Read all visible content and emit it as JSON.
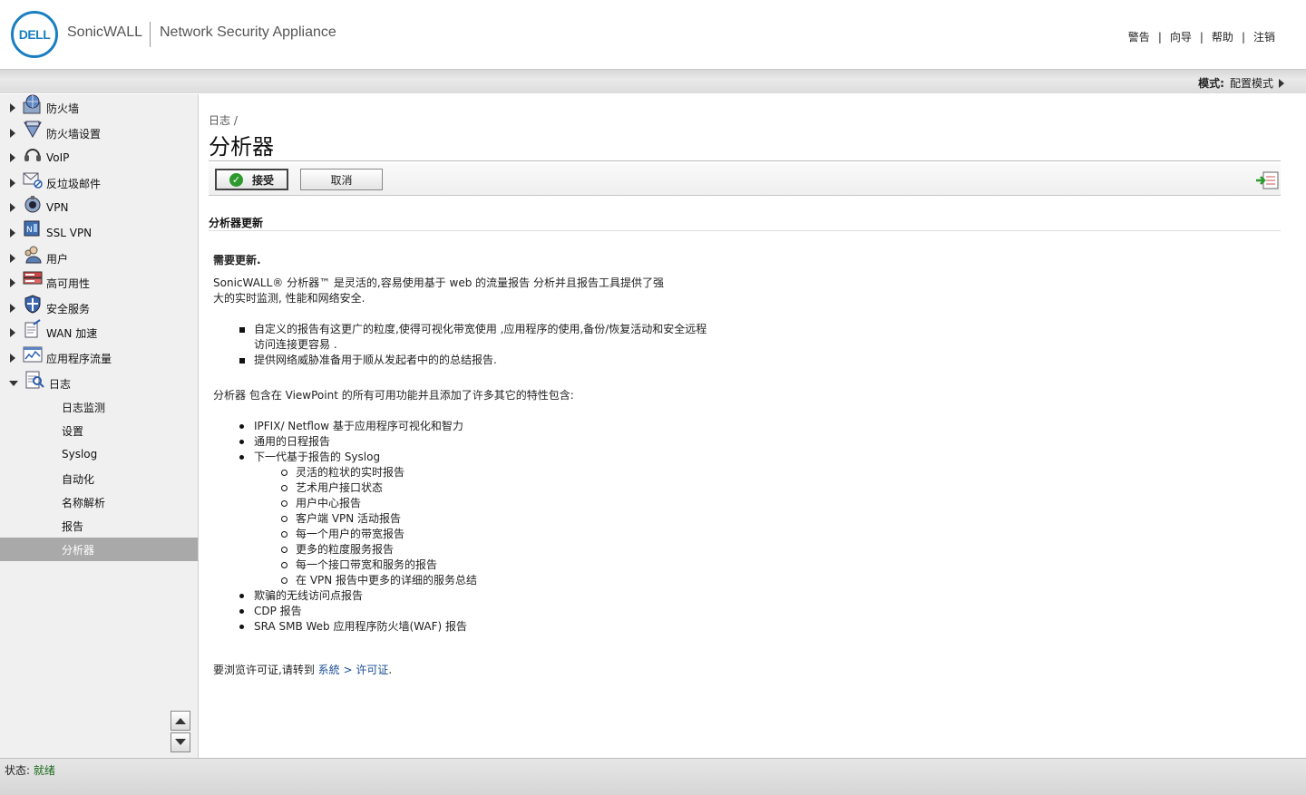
{
  "header": {
    "logo_text": "DELL",
    "brand": "SonicWALL",
    "product": "Network Security Appliance",
    "links": [
      "警告",
      "向导",
      "帮助",
      "注销"
    ]
  },
  "modebar": {
    "mode_label": "模式:",
    "mode_value": "配置模式"
  },
  "sidebar": {
    "items": [
      {
        "label": "防火墙",
        "icon": "firewall-icon"
      },
      {
        "label": "防火墙设置",
        "icon": "firewall-settings-icon"
      },
      {
        "label": "VoIP",
        "icon": "headset-icon"
      },
      {
        "label": "反垃圾邮件",
        "icon": "mail-icon"
      },
      {
        "label": "VPN",
        "icon": "lock-icon"
      },
      {
        "label": "SSL VPN",
        "icon": "ssl-vpn-icon"
      },
      {
        "label": "用户",
        "icon": "users-icon"
      },
      {
        "label": "高可用性",
        "icon": "server-icon"
      },
      {
        "label": "安全服务",
        "icon": "shield-icon"
      },
      {
        "label": "WAN 加速",
        "icon": "document-arrow-icon"
      },
      {
        "label": "应用程序流量",
        "icon": "chart-icon"
      },
      {
        "label": "日志",
        "icon": "log-search-icon"
      }
    ],
    "subitems": [
      "日志监测",
      "设置",
      "Syslog",
      "自动化",
      "名称解析",
      "报告",
      "分析器"
    ]
  },
  "main": {
    "breadcrumb": "日志 /",
    "title": "分析器",
    "accept_label": "接受",
    "cancel_label": "取消",
    "section_title": "分析器更新",
    "need_update": "需要更新.",
    "intro": "SonicWALL® 分析器™ 是灵活的,容易使用基于  web 的流量报告  分析并且报告工具提供了强大的实时监测, 性能和网络安全.",
    "features": [
      "自定义的报告有这更广的粒度,使得可视化带宽使用  ,应用程序的使用,备份/恢复活动和安全远程访问连接更容易  .",
      "提供网络威胁准备用于顺从发起者中的的总结报告."
    ],
    "viewpoint_intro": "分析器  包含在  ViewPoint 的所有可用功能并且添加了许多其它的特性包含:",
    "bullets": [
      "IPFIX/ Netflow 基于应用程序可视化和智力",
      "通用的日程报告",
      "下一代基于报告的  Syslog"
    ],
    "sub_bullets": [
      "灵活的粒状的实时报告",
      "艺术用户接口状态",
      "用户中心报告",
      "客户端  VPN 活动报告",
      "每一个用户的带宽报告",
      "更多的粒度服务报告",
      "每一个接口带宽和服务的报告",
      "在  VPN 报告中更多的详细的服务总结"
    ],
    "bullets2": [
      "欺骗的无线访问点报告",
      "CDP 报告",
      "SRA SMB Web 应用程序防火墙(WAF) 报告"
    ],
    "license_prefix": "要浏览许可证,请转到",
    "license_link1": "系統",
    "license_link2": "> 许可证",
    "license_suffix": "."
  },
  "status": {
    "label": "状态:",
    "value": "就绪"
  }
}
